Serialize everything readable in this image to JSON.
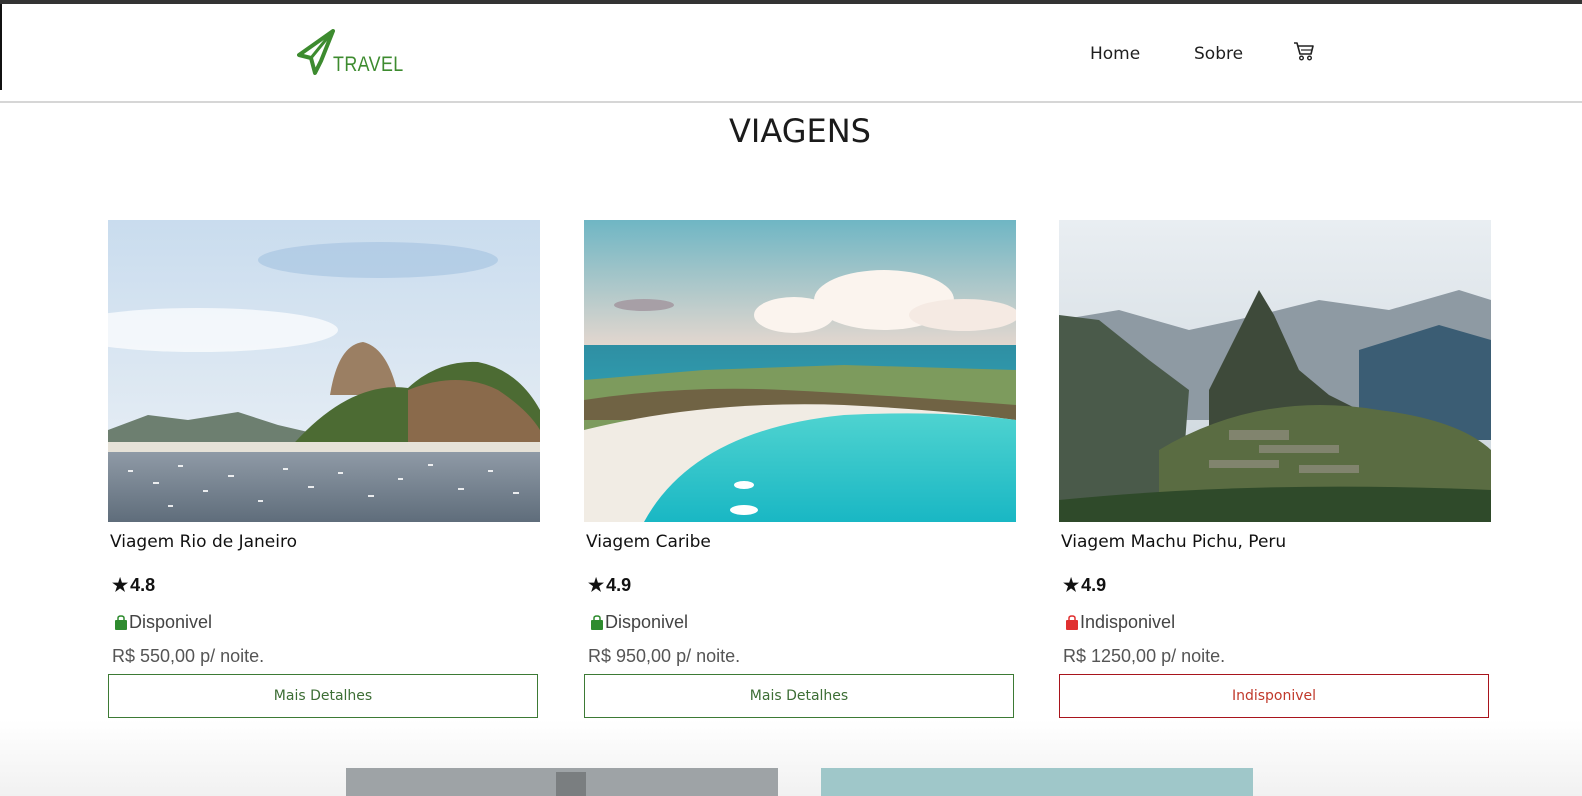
{
  "brand": {
    "logo_text": "TRAVEL",
    "color": "#3d8b2f"
  },
  "nav": {
    "home_label": "Home",
    "about_label": "Sobre",
    "cart_icon": "cart-icon"
  },
  "page": {
    "title": "VIAGENS"
  },
  "trips": [
    {
      "name": "Viagem Rio de Janeiro",
      "rating": "4.8",
      "status": "Disponivel",
      "status_color": "#2e8b2e",
      "price": "R$ 550,00 p/ noite.",
      "button_label": "Mais Detalhes",
      "image": "photo-rio-de-janeiro"
    },
    {
      "name": "Viagem Caribe",
      "rating": "4.9",
      "status": "Disponivel",
      "status_color": "#2e8b2e",
      "price": "R$ 950,00 p/ noite.",
      "button_label": "Mais Detalhes",
      "image": "photo-caribe"
    },
    {
      "name": "Viagem Machu Pichu, Peru",
      "rating": "4.9",
      "status": "Indisponivel",
      "status_color": "#e03030",
      "price": "R$ 1250,00 p/ noite.",
      "button_label": "Indisponivel",
      "image": "photo-machu-picchu"
    }
  ],
  "colors": {
    "available_button": "#3d7a35",
    "unavailable_button": "#a8141c"
  }
}
